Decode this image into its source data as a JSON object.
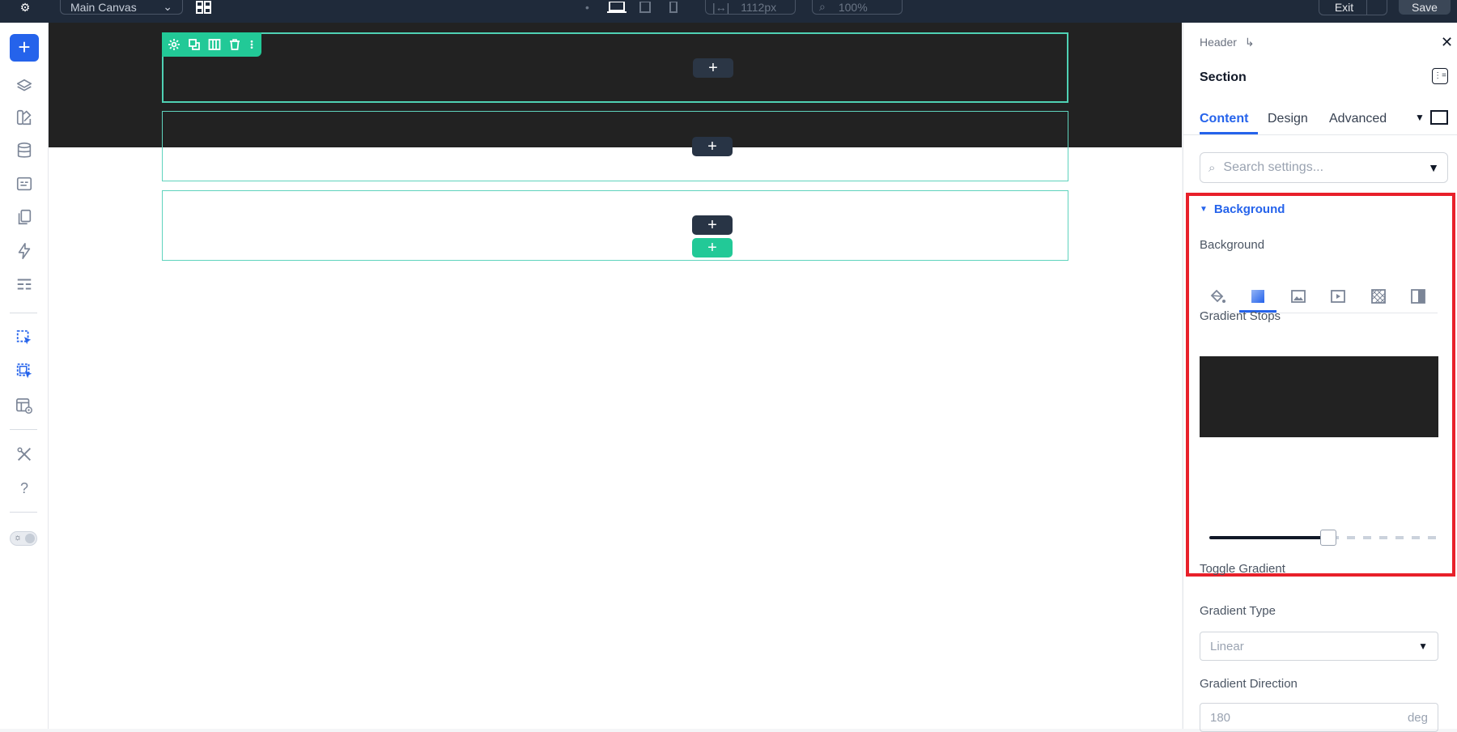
{
  "topbar": {
    "canvas_select": "Main Canvas",
    "width_value": "1112px",
    "zoom_value": "100%",
    "exit_label": "Exit",
    "save_label": "Save"
  },
  "leftbar": {
    "add_label": "+",
    "help_label": "?"
  },
  "canvas": {
    "plus_label": "+"
  },
  "panel": {
    "breadcrumb": "Header",
    "breadcrumb_arrow": "↳",
    "title": "Section",
    "tabs": [
      {
        "label": "Content",
        "active": true
      },
      {
        "label": "Design",
        "active": false
      },
      {
        "label": "Advanced",
        "active": false
      }
    ],
    "search_placeholder": "Search settings...",
    "background_group": "Background",
    "background_label": "Background",
    "background_types": [
      "color-fill-icon",
      "gradient-icon",
      "image-icon",
      "video-icon",
      "pattern-icon",
      "overlay-icon"
    ],
    "active_background_type": "gradient",
    "gradient_stops_label": "Gradient Stops",
    "gradient_preview_color": "#222222",
    "toggle_gradient_label": "Toggle Gradient",
    "gradient_type_label": "Gradient Type",
    "gradient_type_value": "Linear",
    "gradient_direction_label": "Gradient Direction",
    "gradient_direction_value": "180",
    "gradient_direction_unit": "deg"
  },
  "colors": {
    "accent": "#2563eb",
    "section_outline": "#5fd3bd",
    "section_toolbar": "#22c997",
    "highlight": "#e8202a",
    "topbar": "#1f2a3a"
  }
}
